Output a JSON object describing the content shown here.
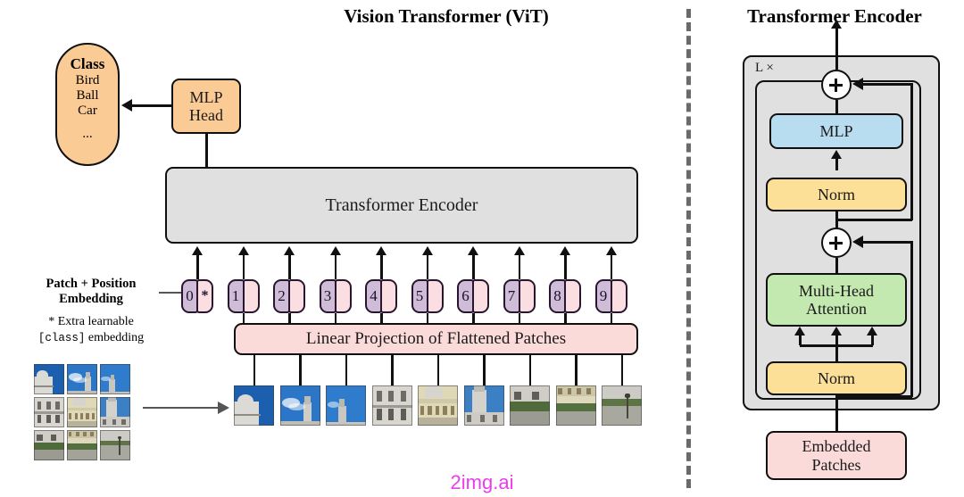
{
  "left_panel": {
    "title": "Vision Transformer (ViT)",
    "class_box": {
      "header": "Class",
      "items": [
        "Bird",
        "Ball",
        "Car"
      ],
      "ellipsis": "...",
      "color": "#fbcb95"
    },
    "mlp_head": {
      "line1": "MLP",
      "line2": "Head",
      "color": "#fbcb95"
    },
    "transformer_encoder": {
      "label": "Transformer Encoder",
      "color": "#e0e0e0"
    },
    "linear_projection": {
      "label": "Linear Projection of Flattened Patches",
      "color": "#fbdada"
    },
    "patch_position_label": {
      "line1": "Patch + Position",
      "line2": "Embedding"
    },
    "extra_learnable_note": {
      "prefix": "* Extra learnable",
      "mono": "[class]",
      "suffix": " embedding"
    },
    "tokens": [
      {
        "number": "0",
        "marker": "*"
      },
      {
        "number": "1",
        "marker": ""
      },
      {
        "number": "2",
        "marker": ""
      },
      {
        "number": "3",
        "marker": ""
      },
      {
        "number": "4",
        "marker": ""
      },
      {
        "number": "5",
        "marker": ""
      },
      {
        "number": "6",
        "marker": ""
      },
      {
        "number": "7",
        "marker": ""
      },
      {
        "number": "8",
        "marker": ""
      },
      {
        "number": "9",
        "marker": ""
      }
    ],
    "token_colors": {
      "index_pill": "#cfbcd6",
      "embed_pill": "#fbdee2"
    },
    "patch_count": 9,
    "source_grid": {
      "rows": 3,
      "cols": 3
    }
  },
  "right_panel": {
    "title": "Transformer Encoder",
    "repeat_label": "L ×",
    "blocks": [
      {
        "name": "mlp",
        "label": "MLP",
        "color": "#b8ddf0"
      },
      {
        "name": "norm2",
        "label": "Norm",
        "color": "#fce098"
      },
      {
        "name": "mha",
        "line1": "Multi-Head",
        "line2": "Attention",
        "color": "#c3e8b0"
      },
      {
        "name": "norm1",
        "label": "Norm",
        "color": "#fce098"
      },
      {
        "name": "embedded_patches",
        "line1": "Embedded",
        "line2": "Patches",
        "color": "#fbdada"
      }
    ],
    "residual_adds": 2,
    "attention_input_arrows": 3,
    "panel_color": "#e0e0e0"
  },
  "watermark": "2img.ai",
  "divider": {
    "style": "dashed",
    "color": "#6a6a6a"
  }
}
